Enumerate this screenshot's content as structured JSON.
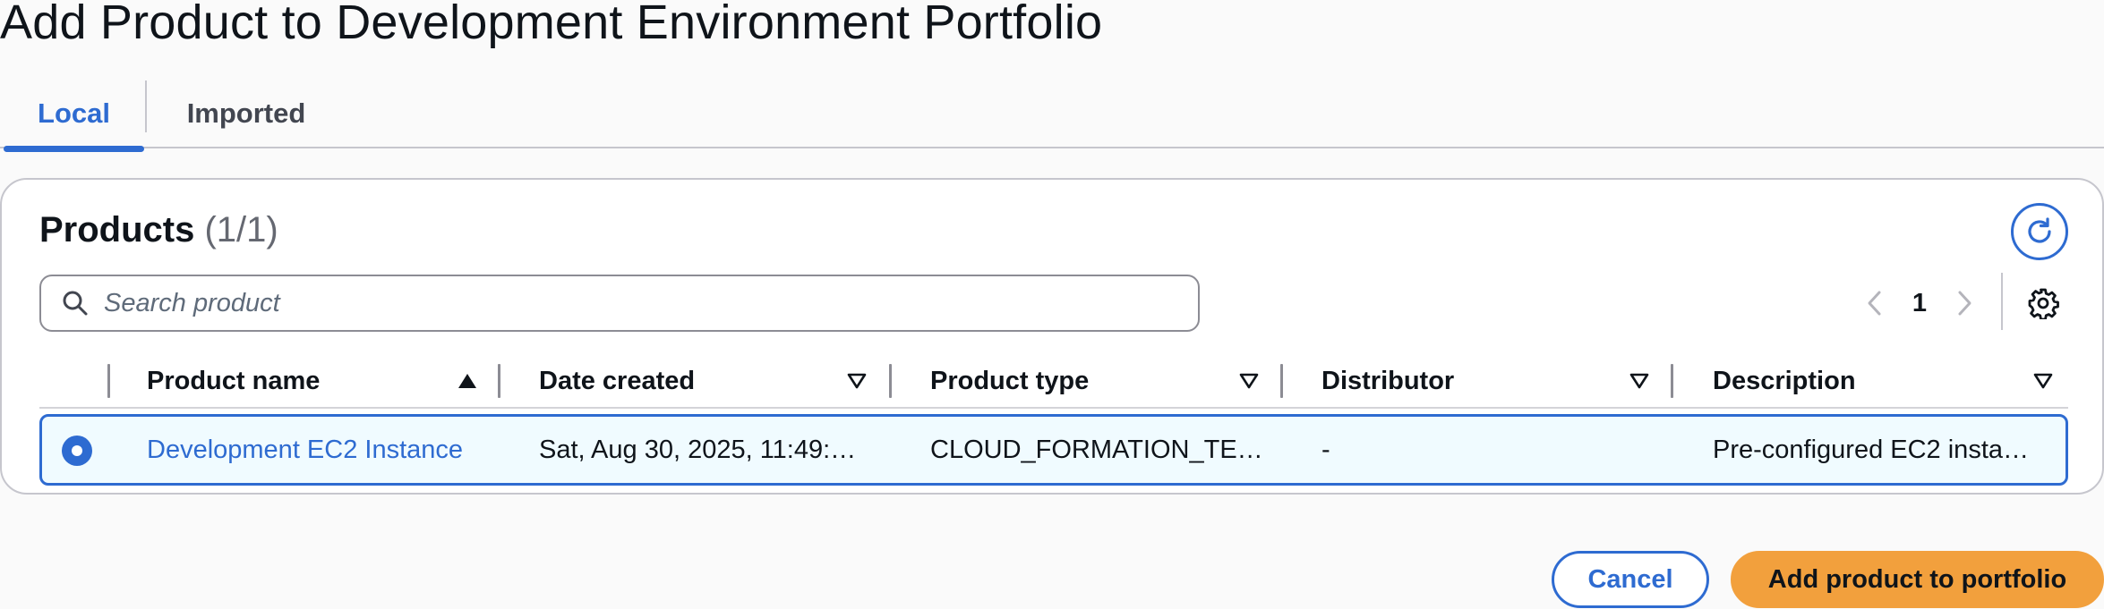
{
  "page": {
    "title": "Add Product to Development Environment Portfolio"
  },
  "tabs": [
    {
      "label": "Local",
      "active": true
    },
    {
      "label": "Imported",
      "active": false
    }
  ],
  "products": {
    "heading": "Products",
    "count": "(1/1)",
    "search": {
      "placeholder": "Search product",
      "value": ""
    },
    "pagination": {
      "current_page": "1"
    },
    "columns": [
      {
        "label": "Product name",
        "sort": "ascending"
      },
      {
        "label": "Date created",
        "sort": "none"
      },
      {
        "label": "Product type",
        "sort": "none"
      },
      {
        "label": "Distributor",
        "sort": "none"
      },
      {
        "label": "Description",
        "sort": "none"
      }
    ],
    "rows": [
      {
        "selected": true,
        "product_name": "Development EC2 Instance",
        "date_created": "Sat, Aug 30, 2025, 11:49:…",
        "product_type": "CLOUD_FORMATION_TE…",
        "distributor": "-",
        "description": "Pre-configured EC2 insta…"
      }
    ]
  },
  "actions": {
    "cancel_label": "Cancel",
    "primary_label": "Add product to portfolio"
  },
  "colors": {
    "accent": "#2e6bd1",
    "primary_button": "#f2a03d",
    "selected_row_bg": "#f0fbff"
  },
  "icons": [
    "search-icon",
    "refresh-icon",
    "chevron-left-icon",
    "chevron-right-icon",
    "gear-icon",
    "sort-ascending-icon",
    "sort-icon"
  ]
}
